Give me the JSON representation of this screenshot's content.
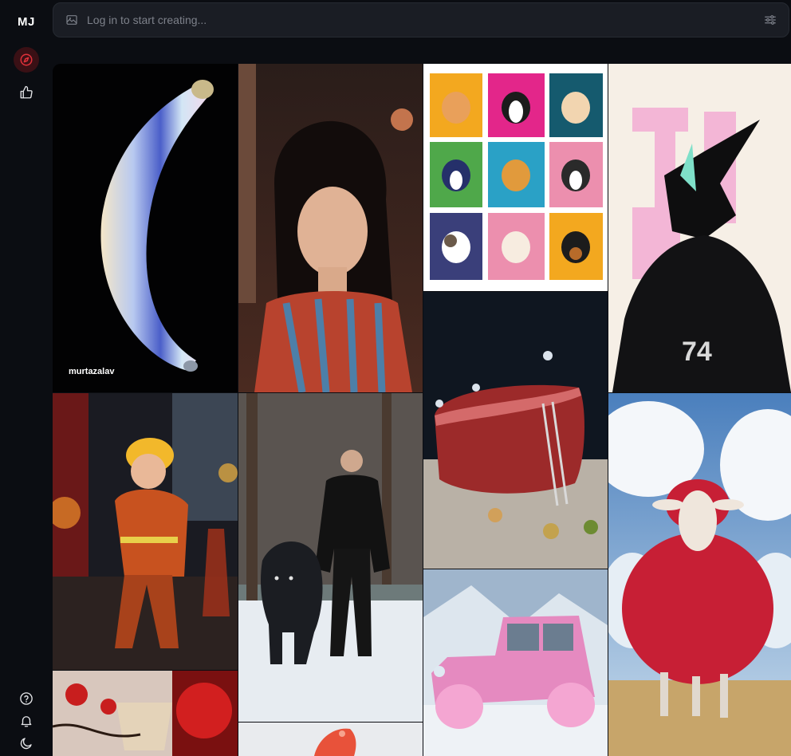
{
  "app": {
    "logo": "MJ"
  },
  "sidebar": {
    "nav": [
      {
        "icon": "compass-icon",
        "active": true
      },
      {
        "icon": "thumbs-up-icon",
        "active": false
      }
    ],
    "bottom": [
      {
        "icon": "help-icon"
      },
      {
        "icon": "bell-icon"
      },
      {
        "icon": "moon-icon"
      }
    ]
  },
  "prompt": {
    "placeholder": "Log in to start creating..."
  },
  "gallery": {
    "tiles": [
      {
        "id": "banana",
        "author": "murtazalav"
      },
      {
        "id": "portrait"
      },
      {
        "id": "dogs"
      },
      {
        "id": "robot",
        "number": "74"
      },
      {
        "id": "firefighter"
      },
      {
        "id": "wolf-man"
      },
      {
        "id": "steak"
      },
      {
        "id": "sheep"
      },
      {
        "id": "pink-jeep"
      },
      {
        "id": "chandelier"
      },
      {
        "id": "bird"
      }
    ]
  },
  "colors": {
    "accent": "#e0313a",
    "background": "#0b0d12",
    "input_bg": "#1a1d24"
  }
}
